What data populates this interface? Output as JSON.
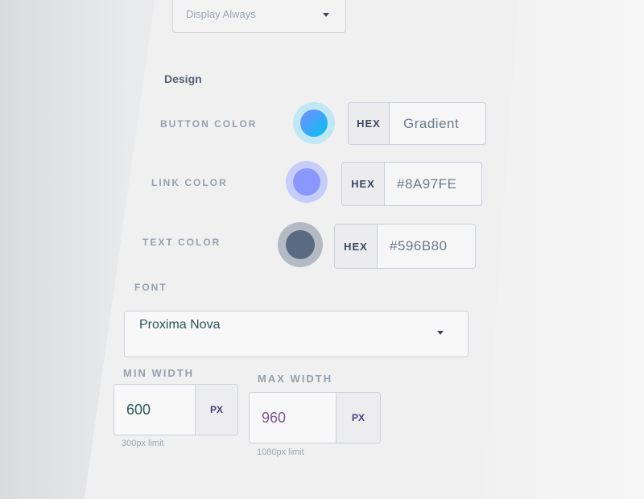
{
  "display_select": {
    "value": "Display Always"
  },
  "design": {
    "title": "Design",
    "button_color": {
      "label": "BUTTON COLOR",
      "tag": "HEX",
      "value": "Gradient",
      "gradient_from": "#7A8BFF",
      "gradient_to": "#00C3F0"
    },
    "link_color": {
      "label": "LINK COLOR",
      "tag": "HEX",
      "value": "#8A97FE",
      "color": "#8A97FE"
    },
    "text_color": {
      "label": "TEXT COLOR",
      "tag": "HEX",
      "value": "#596B80",
      "color": "#596B80"
    }
  },
  "font": {
    "label": "FONT",
    "value": "Proxima Nova"
  },
  "min_width": {
    "label": "MIN WIDTH",
    "value": "600",
    "unit": "PX",
    "hint": "300px limit"
  },
  "max_width": {
    "label": "MAX WIDTH",
    "value": "960",
    "unit": "PX",
    "hint": "1080px limit"
  }
}
